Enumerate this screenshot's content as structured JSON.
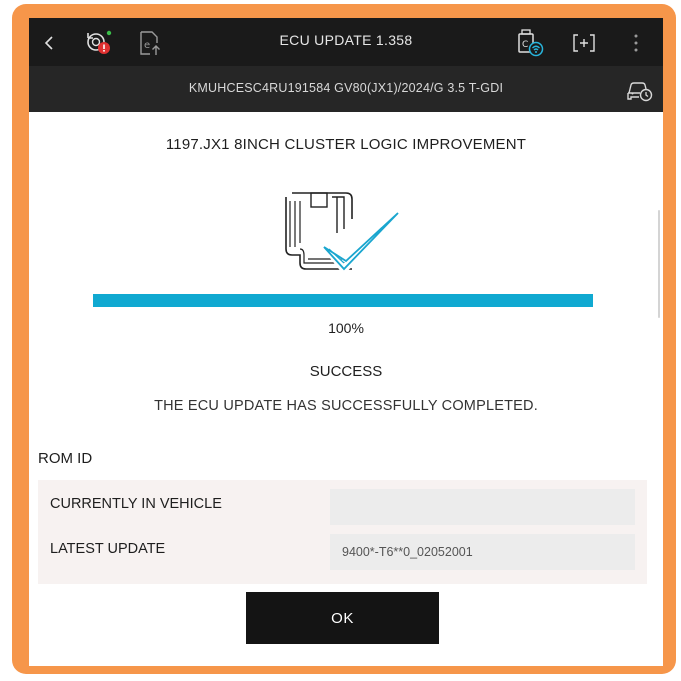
{
  "header": {
    "title": "ECU UPDATE 1.358",
    "icons": [
      "back-icon",
      "ecu-reset-warning-icon",
      "export-icon",
      "vci-connection-icon",
      "capture-icon",
      "more-icon"
    ]
  },
  "vehicle": {
    "info": "KMUHCESC4RU191584  GV80(JX1)/2024/G 3.5 T-GDI",
    "icon": "vehicle-info-icon"
  },
  "update": {
    "name": "1197.JX1 8INCH CLUSTER LOGIC IMPROVEMENT",
    "progress_percent": 100,
    "progress_label": "100%",
    "status": "SUCCESS",
    "message": "THE ECU UPDATE HAS SUCCESSFULLY COMPLETED."
  },
  "rom": {
    "heading": "ROM ID",
    "rows": [
      {
        "label": "CURRENTLY IN VEHICLE",
        "value": ""
      },
      {
        "label": "LATEST UPDATE",
        "value": "9400*-T6**0_02052001"
      }
    ]
  },
  "actions": {
    "ok_label": "OK"
  },
  "colors": {
    "frame": "#f6964a",
    "toolbar": "#1a1a1a",
    "progress": "#10a9d1",
    "check": "#1aa6cf",
    "warning_badge": "#e03131",
    "status_dot": "#3bbf4a"
  }
}
